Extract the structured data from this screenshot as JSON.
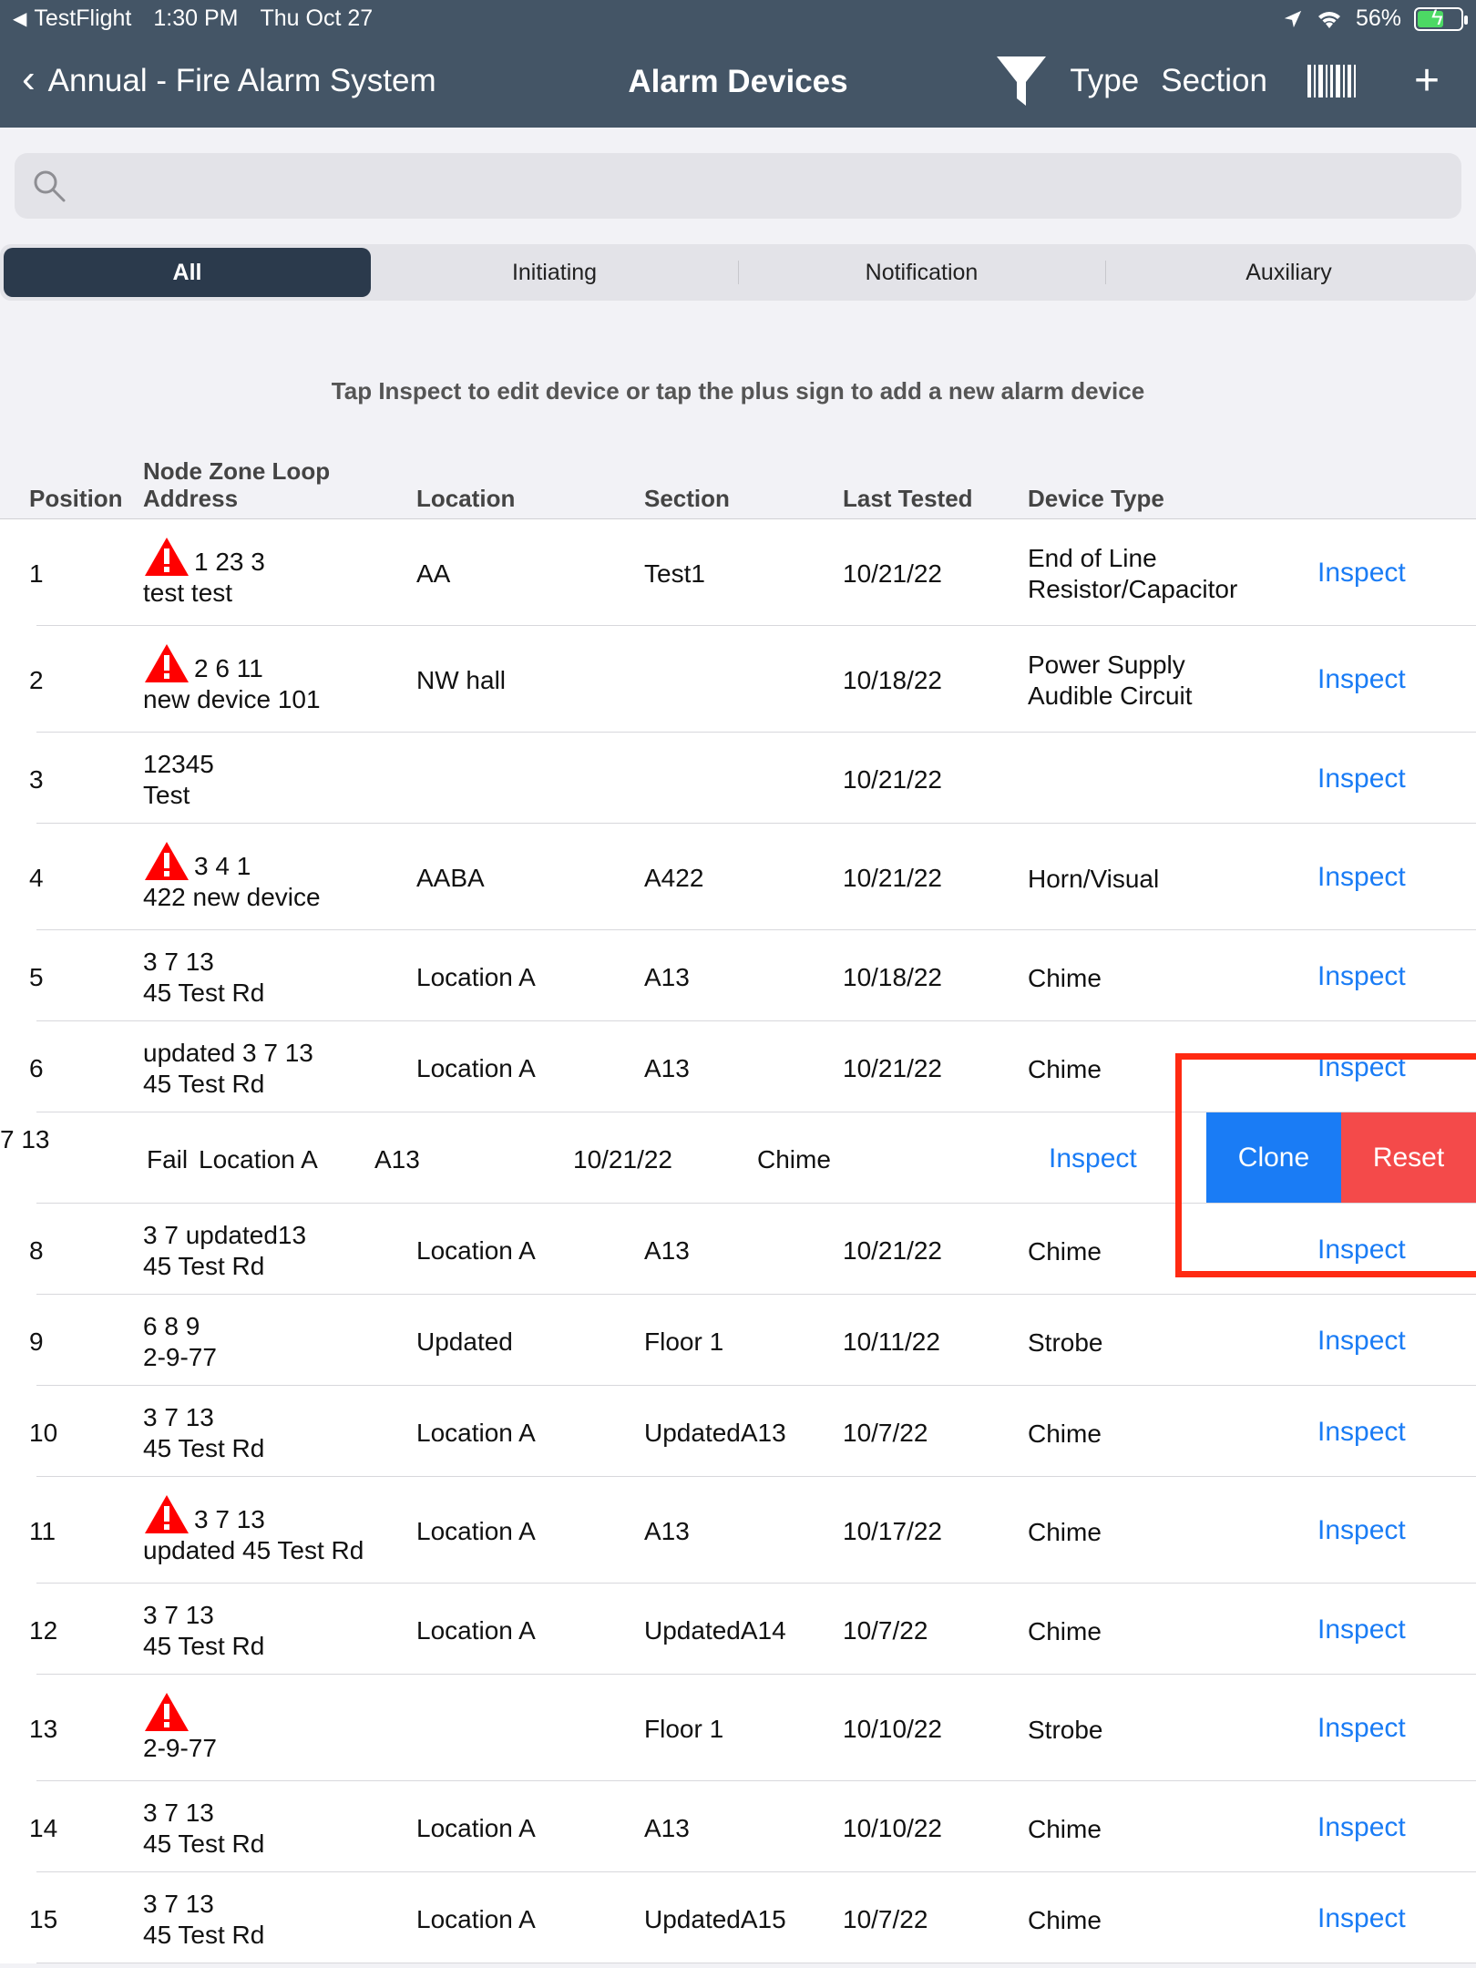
{
  "status_bar": {
    "app": "TestFlight",
    "time": "1:30 PM",
    "date": "Thu Oct 27",
    "battery": "56%"
  },
  "nav": {
    "back_label": "Annual - Fire Alarm System",
    "title": "Alarm Devices",
    "type_label": "Type",
    "section_label": "Section"
  },
  "search": {
    "placeholder": ""
  },
  "segments": [
    "All",
    "Initiating",
    "Notification",
    "Auxiliary"
  ],
  "hint": "Tap Inspect to edit device or tap the plus sign to add a new alarm device",
  "columns": {
    "position": "Position",
    "address_1": "Node Zone Loop",
    "address_2": "Address",
    "location": "Location",
    "section": "Section",
    "last_tested": "Last Tested",
    "device_type": "Device Type"
  },
  "inspect_label": "Inspect",
  "rows": [
    {
      "position": "1",
      "addr1": "1 23 3",
      "addr2": "test test",
      "location": "AA",
      "section": "Test1",
      "tested": "10/21/22",
      "type1": "End of Line",
      "type2": "Resistor/Capacitor"
    },
    {
      "position": "2",
      "addr1": "2 6 11",
      "addr2": "new device 101",
      "location": "NW hall",
      "section": "",
      "tested": "10/18/22",
      "type1": "Power Supply",
      "type2": "Audible Circuit"
    },
    {
      "position": "3",
      "addr1": " 12345",
      "addr2": "Test",
      "location": "",
      "section": "",
      "tested": "10/21/22",
      "type1": "",
      "type2": ""
    },
    {
      "position": "4",
      "addr1": "3 4 1",
      "addr2": "422 new device",
      "location": "AABA",
      "section": "A422",
      "tested": "10/21/22",
      "type1": "Horn/Visual",
      "type2": ""
    },
    {
      "position": "5",
      "addr1": "3 7 13",
      "addr2": "45 Test Rd",
      "location": "Location A",
      "section": "A13",
      "tested": "10/18/22",
      "type1": "Chime",
      "type2": ""
    },
    {
      "position": "6",
      "addr1": "updated 3 7 13",
      "addr2": "45 Test Rd",
      "location": "Location A",
      "section": "A13",
      "tested": "10/21/22",
      "type1": "Chime",
      "type2": ""
    },
    {
      "position": "8",
      "addr1": "3 7 updated13",
      "addr2": "45 Test Rd",
      "location": "Location A",
      "section": "A13",
      "tested": "10/21/22",
      "type1": "Chime",
      "type2": ""
    },
    {
      "position": "9",
      "addr1": "6 8 9",
      "addr2": "2-9-77",
      "location": "Updated",
      "section": "Floor 1",
      "tested": "10/11/22",
      "type1": "Strobe",
      "type2": ""
    },
    {
      "position": "10",
      "addr1": "3 7 13",
      "addr2": "45 Test Rd",
      "location": "Location A",
      "section": "UpdatedA13",
      "tested": "10/7/22",
      "type1": "Chime",
      "type2": ""
    },
    {
      "position": "11",
      "addr1": "3 7 13",
      "addr2": "updated 45 Test Rd",
      "location": "Location A",
      "section": "A13",
      "tested": "10/17/22",
      "type1": "Chime",
      "type2": ""
    },
    {
      "position": "12",
      "addr1": "3 7 13",
      "addr2": "45 Test Rd",
      "location": "Location A",
      "section": "UpdatedA14",
      "tested": "10/7/22",
      "type1": "Chime",
      "type2": ""
    },
    {
      "position": "13",
      "addr1": "",
      "addr2": "2-9-77",
      "location": "",
      "section": "Floor 1",
      "tested": "10/10/22",
      "type1": "Strobe",
      "type2": ""
    },
    {
      "position": "14",
      "addr1": "3 7 13",
      "addr2": "45 Test Rd",
      "location": "Location A",
      "section": "A13",
      "tested": "10/10/22",
      "type1": "Chime",
      "type2": ""
    },
    {
      "position": "15",
      "addr1": "3 7 13",
      "addr2": "45 Test Rd",
      "location": "Location A",
      "section": "UpdatedA15",
      "tested": "10/7/22",
      "type1": "Chime",
      "type2": ""
    }
  ],
  "swiped_row": {
    "fragment": "7 13",
    "address": "Fail",
    "location": "Location A",
    "section": "A13",
    "tested": "10/21/22",
    "type": "Chime",
    "clone_label": "Clone",
    "reset_label": "Reset"
  },
  "colors": {
    "header": "#445566",
    "active_segment": "#2b3a4c",
    "link": "#1a7cf5",
    "clone": "#1a7cf5",
    "reset": "#f44a4a",
    "warning": "#ff0000",
    "highlight": "#ff2a12"
  }
}
